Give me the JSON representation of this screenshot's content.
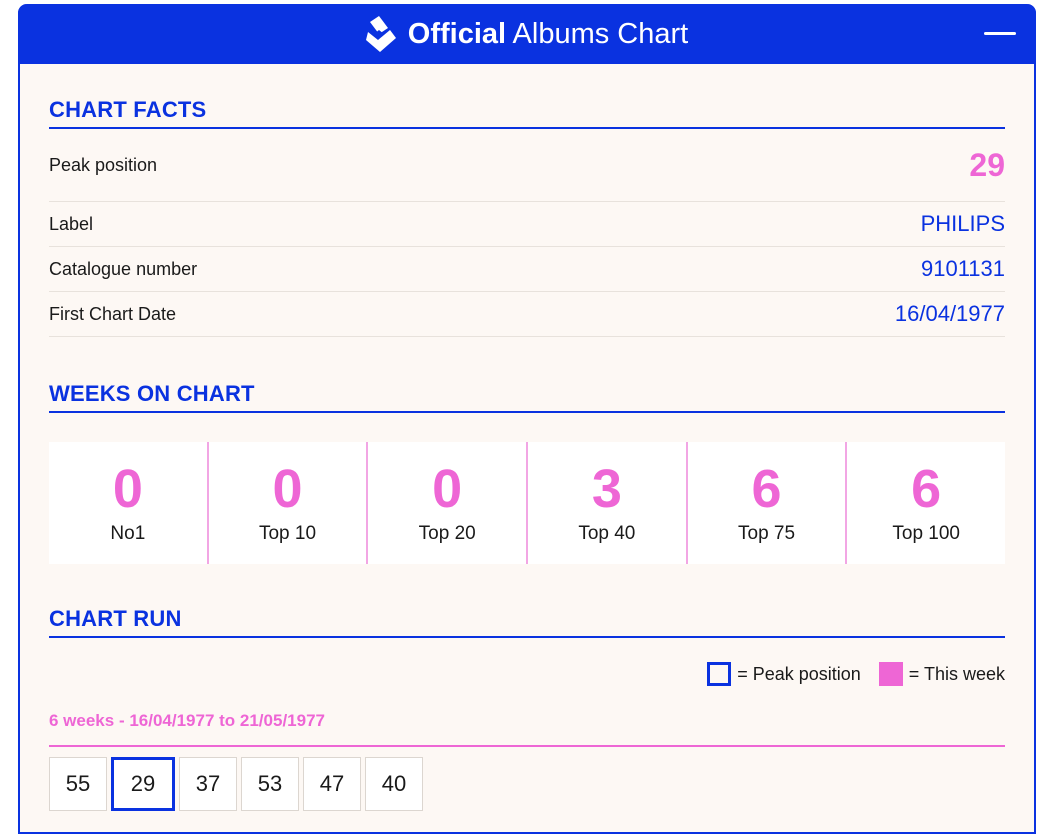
{
  "header": {
    "brand_bold": "Official",
    "brand_light": "Albums Chart",
    "logo_icon": "official-charts-logo-icon",
    "collapse_icon": "minus-icon"
  },
  "colors": {
    "accent": "#0a32e0",
    "highlight": "#ee66d5",
    "panel_bg": "#fdf8f4"
  },
  "chart_facts": {
    "title": "CHART FACTS",
    "rows": [
      {
        "label": "Peak position",
        "value": "29"
      },
      {
        "label": "Label",
        "value": "PHILIPS"
      },
      {
        "label": "Catalogue number",
        "value": "9101131"
      },
      {
        "label": "First Chart Date",
        "value": "16/04/1977"
      }
    ]
  },
  "weeks_on_chart": {
    "title": "WEEKS ON CHART",
    "cells": [
      {
        "count": "0",
        "label": "No1"
      },
      {
        "count": "0",
        "label": "Top 10"
      },
      {
        "count": "0",
        "label": "Top 20"
      },
      {
        "count": "3",
        "label": "Top 40"
      },
      {
        "count": "6",
        "label": "Top 75"
      },
      {
        "count": "6",
        "label": "Top 100"
      }
    ]
  },
  "chart_run": {
    "title": "CHART RUN",
    "legend_peak": "= Peak position",
    "legend_this_week": "= This week",
    "summary": "6 weeks - 16/04/1977 to 21/05/1977",
    "positions": [
      "55",
      "29",
      "37",
      "53",
      "47",
      "40"
    ],
    "peak_index": 1
  }
}
